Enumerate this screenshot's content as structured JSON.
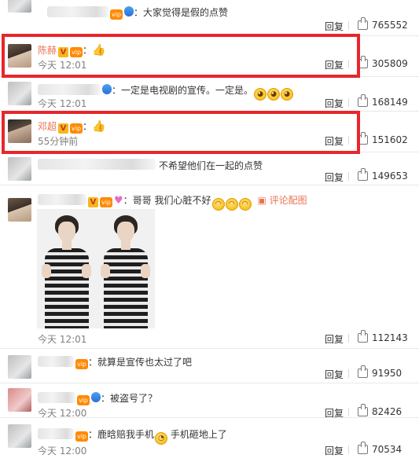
{
  "comments": [
    {
      "name": "",
      "text": "大家觉得是假的点赞",
      "time": "",
      "reply": "回复",
      "likes": "765552"
    },
    {
      "name": "陈赫",
      "text": "",
      "time": "今天 12:01",
      "reply": "回复",
      "likes": "305809"
    },
    {
      "name": "",
      "text": "一定是电视剧的宣传。一定是。",
      "time": "今天 12:01",
      "reply": "回复",
      "likes": "168149"
    },
    {
      "name": "邓超",
      "text": "",
      "time": "55分钟前",
      "reply": "回复",
      "likes": "151602"
    },
    {
      "name": "",
      "text": "不希望他们在一起的点赞",
      "time": "",
      "reply": "回复",
      "likes": "149653"
    },
    {
      "name": "",
      "text": "哥哥 我们心脏不好",
      "pic_link": "评论配图",
      "time": "今天 12:01",
      "reply": "回复",
      "likes": "112143"
    },
    {
      "name": "",
      "text": "就算是宣传也太过了吧",
      "time": "",
      "reply": "回复",
      "likes": "91950"
    },
    {
      "name": "",
      "text": "被盗号了？",
      "time": "今天 12:00",
      "reply": "回复",
      "likes": "82426"
    },
    {
      "name": "",
      "text": "鹿晗赔我手机",
      "text2": "手机砸地上了",
      "time": "今天 12:00",
      "reply": "回复",
      "likes": "70534"
    }
  ],
  "icons": {
    "verified_badge": "V",
    "vip_badge": "vip",
    "thumb": "👍"
  },
  "colors": {
    "name": "#eb7350",
    "highlight": "#e8262c",
    "meta": "#808080"
  }
}
